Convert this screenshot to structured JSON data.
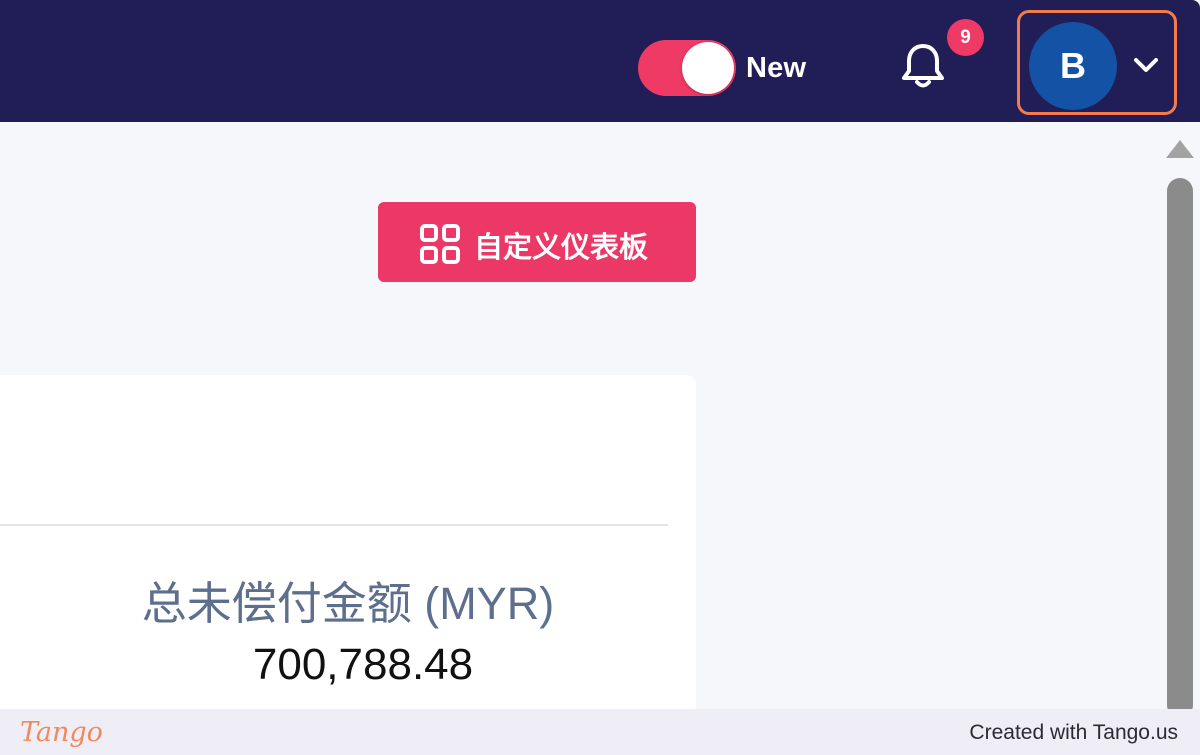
{
  "header": {
    "toggle": {
      "label": "New",
      "state": "on",
      "color": "#ee3a64"
    },
    "notifications": {
      "icon": "bell-icon",
      "count": "9"
    },
    "user": {
      "avatar_initial": "B",
      "menu_icon": "chevron-down-icon",
      "highlight_color": "#f57b4a"
    },
    "background_color": "#211d57"
  },
  "toolbar": {
    "customize_dashboard": {
      "icon": "grid-icon",
      "label": "自定义仪表板",
      "color": "#ec3866"
    }
  },
  "card": {
    "metric_label": "总未偿付金额 (MYR)",
    "metric_value": "700,788.48"
  },
  "footer": {
    "logo_text": "Tango",
    "created_with": "Created with Tango.us"
  }
}
